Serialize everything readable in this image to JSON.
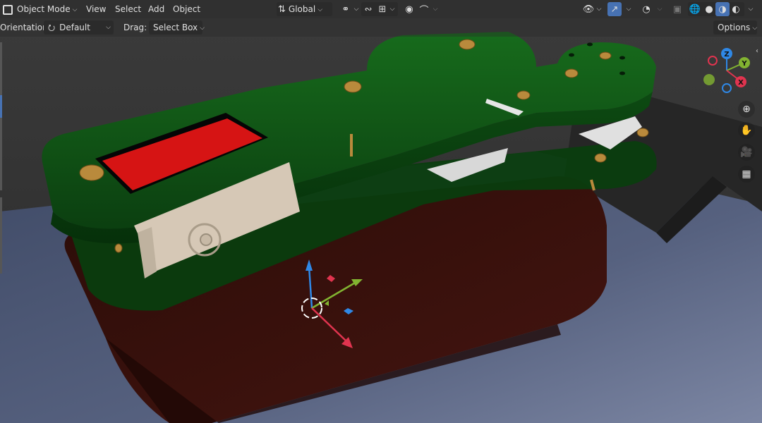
{
  "header": {
    "mode_label": "Object Mode",
    "menus": [
      "View",
      "Select",
      "Add",
      "Object"
    ],
    "transform_orientation": "Global"
  },
  "tool_settings": {
    "orientation_label": "Orientation:",
    "orientation_value": "Default",
    "drag_label": "Drag:",
    "drag_value": "Select Box",
    "options_label": "Options"
  },
  "gizmo": {
    "axes": [
      "Z",
      "Y",
      "X"
    ]
  },
  "colors": {
    "header_bg": "#282828",
    "accent": "#4772b3",
    "axis_x": "#e0344f",
    "axis_y": "#82b331",
    "axis_z": "#2f88e6",
    "board_green": "#0f4a14",
    "screen_red": "#d81515",
    "base_plate": "#3a0d0a",
    "floor": "#4c5675"
  },
  "icons": {
    "mode": "object-mode-icon",
    "orientation": "transform-orientation-icon",
    "pivot": "pivot-point-icon",
    "snap": "snap-icon",
    "snap_target": "snap-increment-icon",
    "proportional": "proportional-editing-icon",
    "falloff": "falloff-curve-icon",
    "visibility": "eye-icon",
    "gizmos": "gizmo-icon",
    "overlays": "overlays-icon",
    "xray": "xray-icon",
    "shading": [
      "wireframe-shading-icon",
      "solid-shading-icon",
      "material-shading-icon",
      "rendered-shading-icon"
    ],
    "navigation": [
      "zoom-icon",
      "hand-icon",
      "camera-icon",
      "grid-icon"
    ]
  }
}
